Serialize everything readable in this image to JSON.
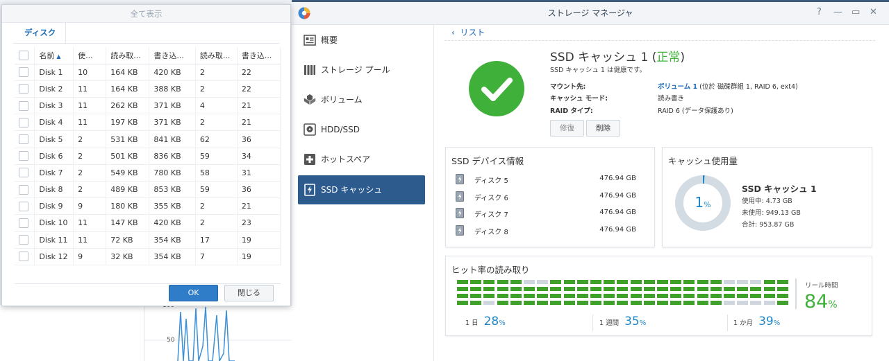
{
  "background": {
    "chart_tick_top": "100",
    "chart_tick_mid": "50"
  },
  "dialog": {
    "title": "全て表示",
    "tab": "ディスク",
    "columns": [
      "名前",
      "使...",
      "読み取...",
      "書き込...",
      "読み取...",
      "書き込..."
    ],
    "rows": [
      [
        "Disk 1",
        "10",
        "164 KB",
        "420 KB",
        "2",
        "22"
      ],
      [
        "Disk 2",
        "11",
        "164 KB",
        "388 KB",
        "2",
        "22"
      ],
      [
        "Disk 3",
        "11",
        "262 KB",
        "371 KB",
        "4",
        "21"
      ],
      [
        "Disk 4",
        "11",
        "197 KB",
        "371 KB",
        "2",
        "21"
      ],
      [
        "Disk 5",
        "2",
        "531 KB",
        "841 KB",
        "62",
        "36"
      ],
      [
        "Disk 6",
        "2",
        "501 KB",
        "836 KB",
        "59",
        "34"
      ],
      [
        "Disk 7",
        "2",
        "549 KB",
        "780 KB",
        "58",
        "31"
      ],
      [
        "Disk 8",
        "2",
        "489 KB",
        "853 KB",
        "59",
        "36"
      ],
      [
        "Disk 9",
        "9",
        "180 KB",
        "355 KB",
        "2",
        "21"
      ],
      [
        "Disk 10",
        "11",
        "147 KB",
        "420 KB",
        "2",
        "23"
      ],
      [
        "Disk 11",
        "11",
        "72 KB",
        "354 KB",
        "17",
        "19"
      ],
      [
        "Disk 12",
        "9",
        "32 KB",
        "354 KB",
        "7",
        "19"
      ]
    ],
    "ok_label": "OK",
    "close_label": "閉じる"
  },
  "window": {
    "title": "ストレージ マネージャ",
    "help_glyph": "?",
    "min_glyph": "—",
    "max_glyph": "▭",
    "close_glyph": "✕"
  },
  "sidebar": {
    "items": [
      {
        "label": "概要",
        "icon": "overview-icon"
      },
      {
        "label": "ストレージ プール",
        "icon": "storage-pool-icon"
      },
      {
        "label": "ボリューム",
        "icon": "volume-icon"
      },
      {
        "label": "HDD/SSD",
        "icon": "hdd-icon"
      },
      {
        "label": "ホットスペア",
        "icon": "hotspare-icon"
      },
      {
        "label": "SSD キャッシュ",
        "icon": "ssd-cache-icon",
        "active": true
      }
    ]
  },
  "main": {
    "back_label": "リスト",
    "cache_title": "SSD キャッシュ 1 (",
    "cache_status": "正常",
    "cache_title_end": ")",
    "cache_sub": "SSD キャッシュ 1 は健康です。",
    "mount_label": "マウント先:",
    "mount_volume": "ボリューム 1",
    "mount_detail": " (位於 磁碟群組 1, RAID 6, ext4)",
    "mode_label": "キャッシュ モード:",
    "mode_value": "読み書き",
    "raid_label": "RAID タイプ:",
    "raid_value": "RAID 6 (データ保護あり)",
    "repair_label": "修復",
    "delete_label": "削除"
  },
  "devices": {
    "title": "SSD デバイス情報",
    "items": [
      {
        "name": "ディスク 5",
        "size": "476.94 GB"
      },
      {
        "name": "ディスク 6",
        "size": "476.94 GB"
      },
      {
        "name": "ディスク 7",
        "size": "476.94 GB"
      },
      {
        "name": "ディスク 8",
        "size": "476.94 GB"
      }
    ]
  },
  "usage": {
    "title": "キャッシュ使用量",
    "percent": "1",
    "percent_value": 1,
    "percent_unit": "%",
    "name": "SSD キャッシュ 1",
    "used": "使用中: 4.73 GB",
    "unused": "未使用: 949.13 GB",
    "total": "合計: 953.87 GB"
  },
  "hitrate": {
    "title": "ヒット率の読み取り",
    "real_label": "リール時間",
    "real_value": "84",
    "real_unit": "%",
    "stats": [
      {
        "label": "1 日",
        "value": "28",
        "unit": "%"
      },
      {
        "label": "1 週間",
        "value": "35",
        "unit": "%"
      },
      {
        "label": "1 か月",
        "value": "39",
        "unit": "%"
      }
    ],
    "grid_pattern": [
      "1111100111111111111100011",
      "1111111111111111111111111",
      "1111111111111111111111111",
      "1101111111111111111100001"
    ]
  },
  "colors": {
    "accent": "#2d5b8e",
    "link": "#1d6bb8",
    "ok_green": "#3fb13a",
    "hit_green": "#3fa12a",
    "hit_gray": "#cfd6dd",
    "donut_track": "#d3dbe3",
    "donut_fill": "#1d86c8"
  }
}
